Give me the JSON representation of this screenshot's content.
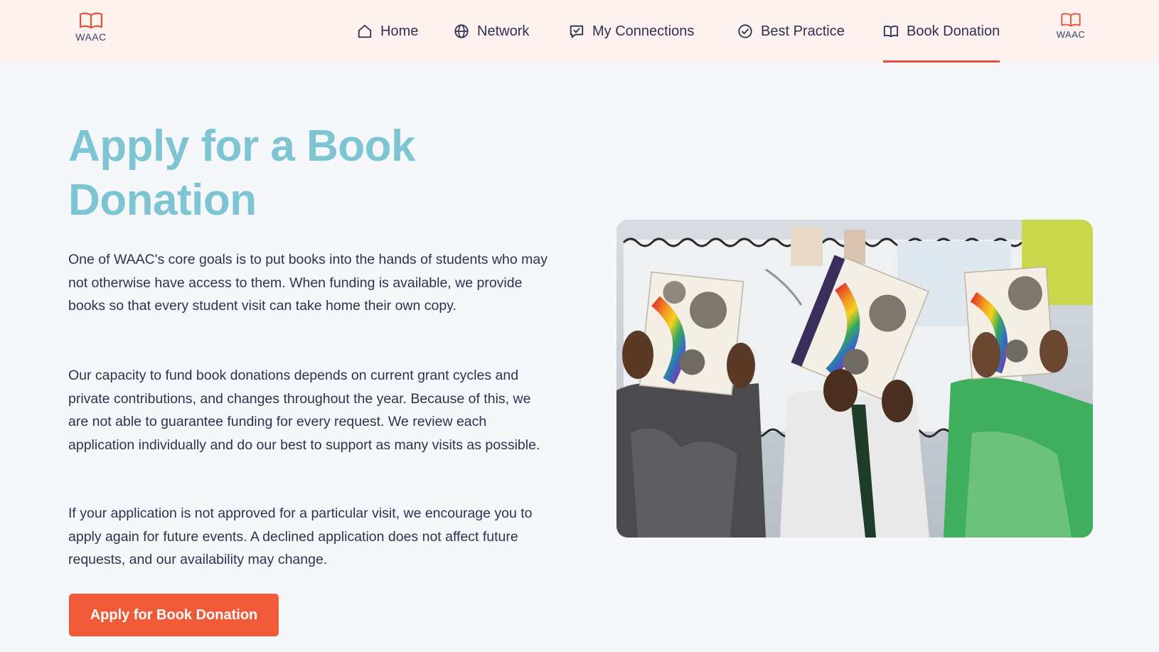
{
  "header": {
    "logo_text": "WAAC",
    "logo_right_text": "WAAC",
    "nav": [
      {
        "label": "Home",
        "icon": "home-icon"
      },
      {
        "label": "Network",
        "icon": "globe-icon"
      },
      {
        "label": "My Connections",
        "icon": "chat-check-icon"
      },
      {
        "label": "Best Practice",
        "icon": "check-circle-icon"
      },
      {
        "label": "Book Donation",
        "icon": "book-icon",
        "active": true
      }
    ]
  },
  "main": {
    "title": "Apply for a Book Donation",
    "paragraphs": [
      "One of WAAC's core goals is to put books into the hands of students who may not otherwise have access to them. When funding is available, we provide books so that every student visit can take home their own copy.",
      "Our capacity to fund book donations depends on current grant cycles and private contributions, and changes throughout the year. Because of this, we are not able to guarantee funding for every request. We review each application individually and do our best to support as many visits as possible.",
      "If your application is not approved for a particular visit, we encourage you to apply again for future events. A declined application does not affect future requests, and our availability may change."
    ],
    "cta_label": "Apply for Book Donation"
  },
  "colors": {
    "accent": "#e4543b",
    "button": "#f05a38",
    "title": "#7ec5d3",
    "header_bg": "#fdf2f0",
    "text": "#2d3250"
  }
}
